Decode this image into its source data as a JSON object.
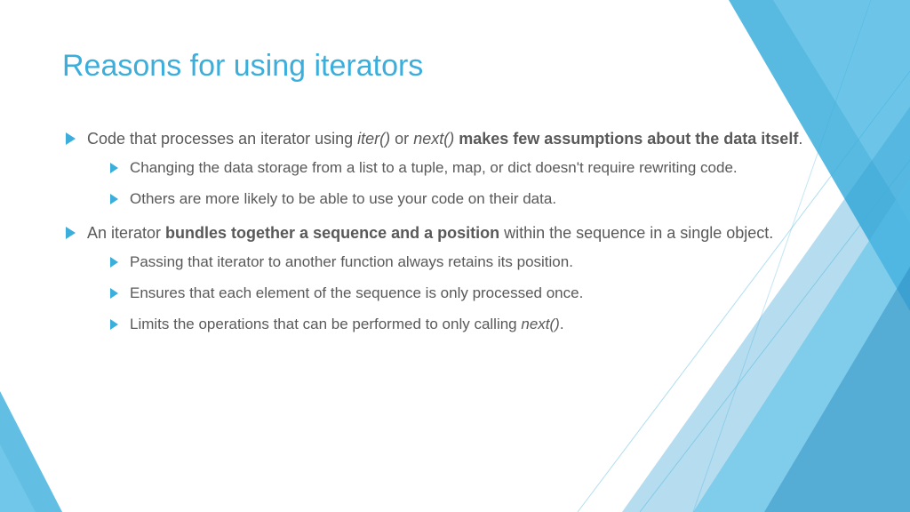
{
  "title": "Reasons for using iterators",
  "bullet1": {
    "pre": "Code that processes an iterator using ",
    "em1": "iter()",
    "mid1": " or ",
    "em2": "next()",
    "mid2": " ",
    "bold": "makes few assumptions about the data itself",
    "post": ".",
    "sub1": "Changing the data storage from a list to a tuple, map, or dict doesn't require rewriting code.",
    "sub2": "Others are more likely to be able to use your code on their data."
  },
  "bullet2": {
    "pre": "An iterator ",
    "bold": "bundles together a sequence and a position",
    "post": " within the sequence in a single object.",
    "sub1": "Passing that iterator to another function always retains its position.",
    "sub2": "Ensures that each element of the sequence is only processed once.",
    "sub3pre": "Limits the operations that can be performed to only calling ",
    "sub3em": "next()",
    "sub3post": "."
  }
}
